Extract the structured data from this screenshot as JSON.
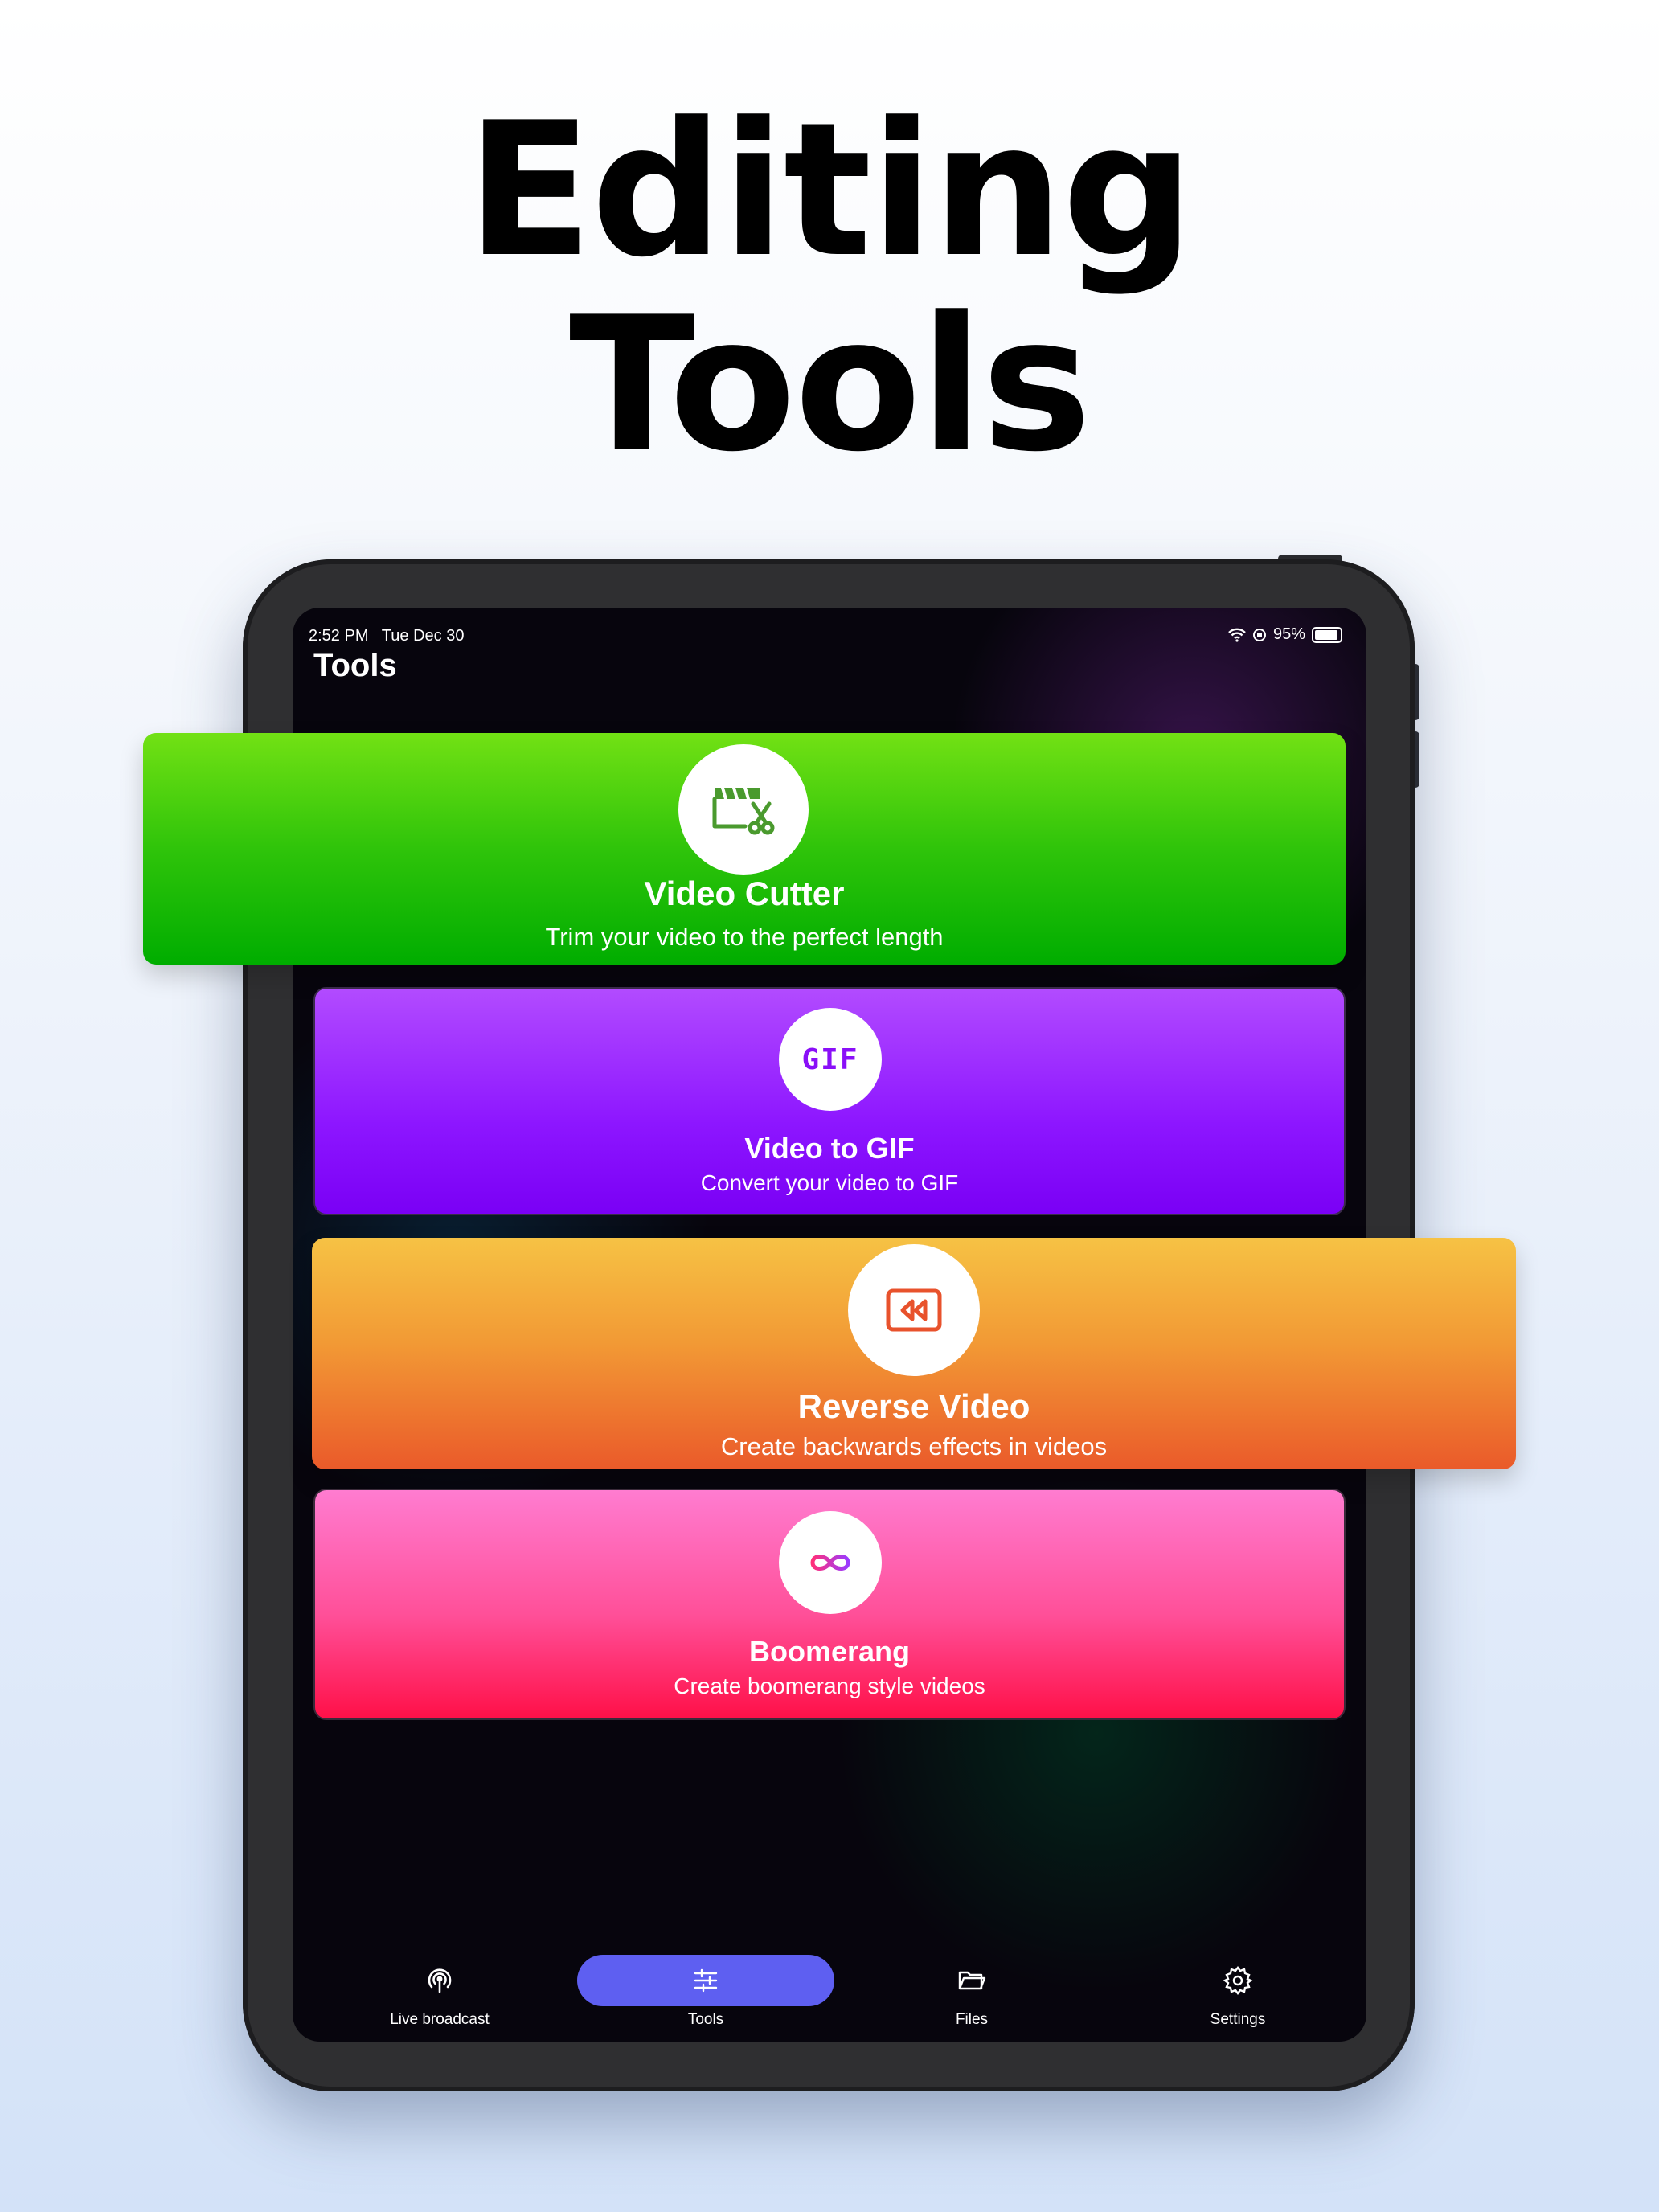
{
  "headline": {
    "line1": "Editing",
    "line2": "Tools"
  },
  "status_bar": {
    "time": "2:52 PM",
    "date": "Tue Dec 30",
    "battery": "95%"
  },
  "screen_title": "Tools",
  "cards": [
    {
      "title": "Video Cutter",
      "subtitle": "Trim your video to the perfect length",
      "icon": "video-cutter-icon",
      "colors": [
        "#72e114",
        "#00ad00"
      ]
    },
    {
      "title": "Video to GIF",
      "subtitle": "Convert your video to GIF",
      "icon": "gif-icon",
      "icon_text": "GIF",
      "colors": [
        "#b24bff",
        "#7a00f5"
      ]
    },
    {
      "title": "Reverse Video",
      "subtitle": "Create backwards effects in videos",
      "icon": "reverse-video-icon",
      "colors": [
        "#f6c244",
        "#ea5a2a"
      ]
    },
    {
      "title": "Boomerang",
      "subtitle": "Create boomerang style videos",
      "icon": "infinity-icon",
      "colors": [
        "#ff7cd0",
        "#ff1048"
      ]
    }
  ],
  "tabs": [
    {
      "label": "Live broadcast",
      "icon": "broadcast-icon",
      "active": false
    },
    {
      "label": "Tools",
      "icon": "sliders-icon",
      "active": true
    },
    {
      "label": "Files",
      "icon": "folder-icon",
      "active": false
    },
    {
      "label": "Settings",
      "icon": "gear-icon",
      "active": false
    }
  ],
  "accent_color": "#5e5ff1"
}
